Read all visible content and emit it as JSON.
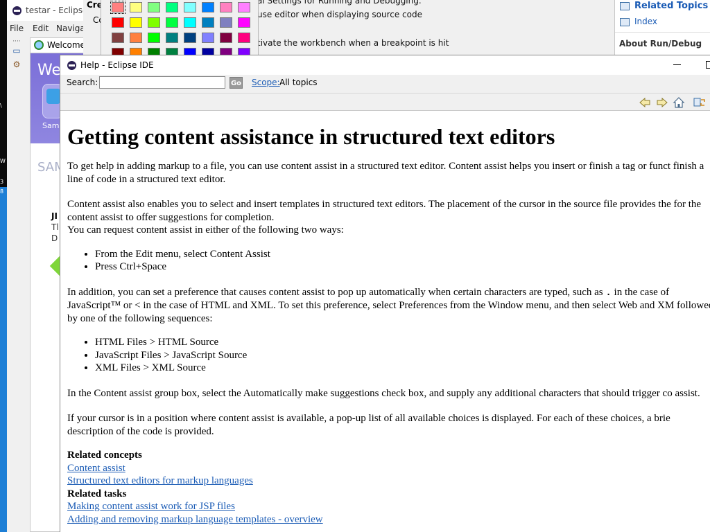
{
  "main_window": {
    "title": "testar - Eclipse I",
    "menu": [
      "File",
      "Edit",
      "Navigat"
    ],
    "welcome_tab": "Welcome",
    "welcome_heading": "We",
    "welcome_sample": "Sam",
    "welcome_sam2": "SAM",
    "welcome_line1": "JI",
    "welcome_line2": "Tl",
    "welcome_line3": "D"
  },
  "pref_dialog": {
    "heading": "Cre",
    "label_co": "Co",
    "line1": "al Settings for Running and Debugging.",
    "line2": "use editor when displaying source code",
    "line3": "tivate the workbench when a breakpoint is hit"
  },
  "color_palette": {
    "rows": [
      [
        "#ff8080",
        "#ffff80",
        "#80ff80",
        "#00ff80",
        "#80ffff",
        "#0080ff",
        "#ff80c0",
        "#ff80ff"
      ],
      [
        "#ff0000",
        "#ffff00",
        "#80ff00",
        "#00ff40",
        "#00ffff",
        "#0080c0",
        "#8080c0",
        "#ff00ff"
      ],
      [
        "#804040",
        "#ff8040",
        "#00ff00",
        "#008080",
        "#004080",
        "#8080ff",
        "#800040",
        "#ff0080"
      ],
      [
        "#800000",
        "#ff8000",
        "#008000",
        "#008040",
        "#0000ff",
        "#0000a0",
        "#800080",
        "#8000ff"
      ]
    ],
    "selected": "#ff8080"
  },
  "related_view": {
    "related_topics": "Related Topics",
    "index": "Index",
    "about": "About Run/Debug"
  },
  "help_window": {
    "title": "Help - Eclipse IDE",
    "search_label": "Search:",
    "search_value": "",
    "go_label": "Go",
    "scope_label": "Scope:",
    "scope_value": "All topics",
    "nav_icons": [
      "back-arrow-icon",
      "forward-arrow-icon",
      "home-icon",
      "sync-toc-icon"
    ]
  },
  "article": {
    "title": "Getting content assistance in structured text editors",
    "p1": "To get help in adding markup to a file, you can use content assist in a structured text editor. Content assist helps you insert or finish a tag or funct finish a line of code in a structured text editor.",
    "p2": "Content assist also enables you to select and insert templates in structured text editors. The placement of the cursor in the source file provides the for the content assist to offer suggestions for completion.",
    "p3": "You can request content assist in either of the following two ways:",
    "ways": [
      "From the Edit menu, select Content Assist",
      "Press Ctrl+Space"
    ],
    "p4_a": "In addition, you can set a preference that causes content assist to pop up automatically when certain characters are typed, such as",
    "p4_code": ".",
    "p4_b": "in the case of JavaScript™ or < in the case of HTML and XML. To set this preference, select Preferences from the Window menu, and then select Web and XM followed by one of the following sequences:",
    "sequences": [
      "HTML Files > HTML Source",
      "JavaScript Files > JavaScript Source",
      "XML Files > XML Source"
    ],
    "p5": "In the Content assist group box, select the Automatically make suggestions check box, and supply any additional characters that should trigger co assist.",
    "p6": "If your cursor is in a position where content assist is available, a pop-up list of all available choices is displayed. For each of these choices, a brie description of the code is provided.",
    "related_concepts_heading": "Related concepts",
    "related_concepts": [
      "Content assist",
      "Structured text editors for markup languages"
    ],
    "related_tasks_heading": "Related tasks",
    "related_tasks": [
      "Making content assist work for JSP files",
      "Adding and removing markup language templates - overview"
    ]
  }
}
